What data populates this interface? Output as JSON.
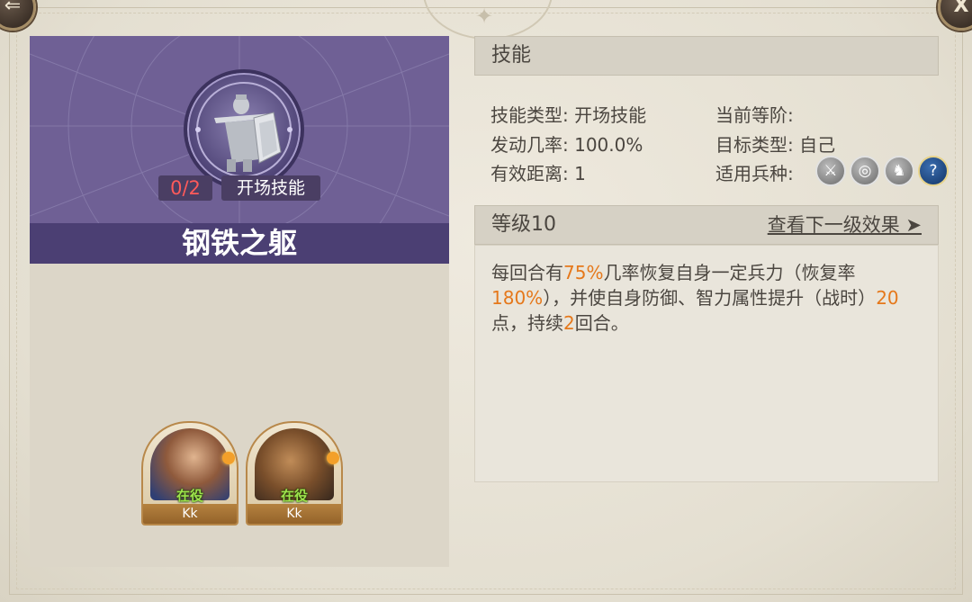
{
  "left_panel": {
    "skill_name": "钢铁之躯",
    "level_progress": "0/2",
    "skill_type_badge": "开场技能",
    "heroes": [
      {
        "status": "在役",
        "player": "Kk"
      },
      {
        "status": "在役",
        "player": "Kk"
      }
    ]
  },
  "skill_section": {
    "header": "技能",
    "fields": {
      "type_label": "技能类型:",
      "type_value": "开场技能",
      "rank_label": "当前等阶:",
      "rank_value": "",
      "chance_label": "发动几率:",
      "chance_value": "100.0%",
      "target_label": "目标类型:",
      "target_value": "自己",
      "range_label": "有效距离:",
      "range_value": "1",
      "troops_label": "适用兵种:"
    },
    "troop_icons": [
      "sword-icon",
      "bow-target-icon",
      "horse-icon",
      "question-icon"
    ]
  },
  "level_section": {
    "header": "等级10",
    "next_link": "查看下一级效果 ➤",
    "description": {
      "p1": "每回合有",
      "h1": "75%",
      "p2": "几率恢复自身一定兵力（恢复率",
      "h2": "180%",
      "p3": "），并使自身防御、智力属性提升（战时）",
      "h3": "20",
      "p4": "点，持续",
      "h4": "2",
      "p5": "回合。"
    }
  },
  "controls": {
    "back_glyph": "⇐",
    "close_glyph": "X"
  },
  "colors": {
    "purple_panel": "#6f6095",
    "name_bar": "#4b3f73",
    "highlight": "#e5781b",
    "level_red": "#ff5a5a",
    "active_green": "#9ee34c"
  }
}
